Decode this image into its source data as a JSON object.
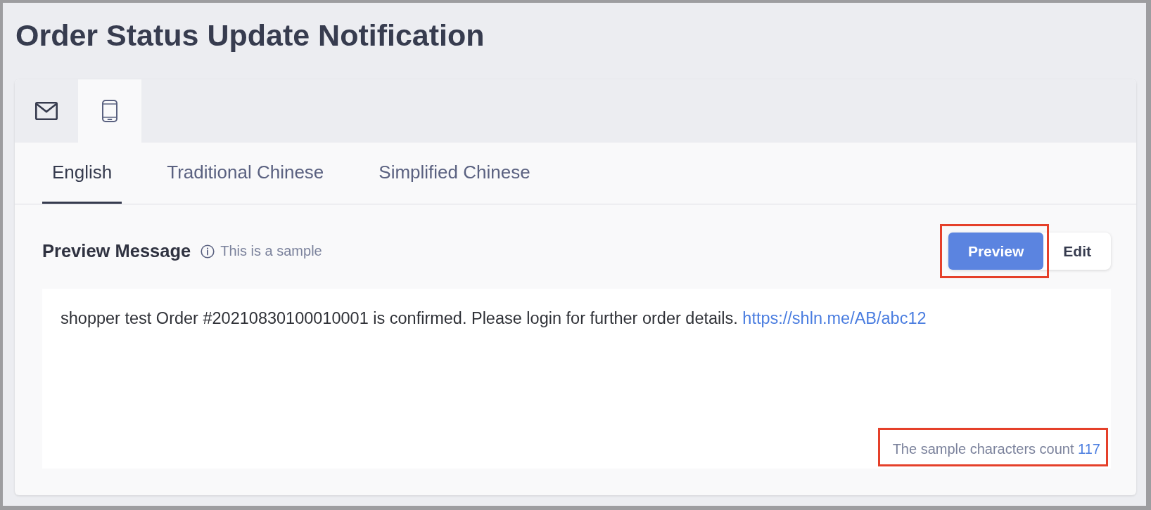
{
  "page": {
    "title": "Order Status Update Notification"
  },
  "channel_tabs": [
    {
      "kind": "email",
      "selected": false
    },
    {
      "kind": "sms",
      "selected": true
    }
  ],
  "language_tabs": [
    {
      "label": "English",
      "selected": true
    },
    {
      "label": "Traditional Chinese",
      "selected": false
    },
    {
      "label": "Simplified Chinese",
      "selected": false
    }
  ],
  "preview": {
    "title": "Preview Message",
    "hint": "This is a sample",
    "modes": [
      {
        "label": "Preview",
        "selected": true,
        "highlighted": true
      },
      {
        "label": "Edit",
        "selected": false,
        "highlighted": false
      }
    ]
  },
  "message": {
    "text": "shopper test Order #20210830100010001 is confirmed. Please login for further order details.",
    "link": "https://shln.me/AB/abc12"
  },
  "char_count": {
    "label": "The sample characters count",
    "value": "117",
    "highlighted": true
  }
}
